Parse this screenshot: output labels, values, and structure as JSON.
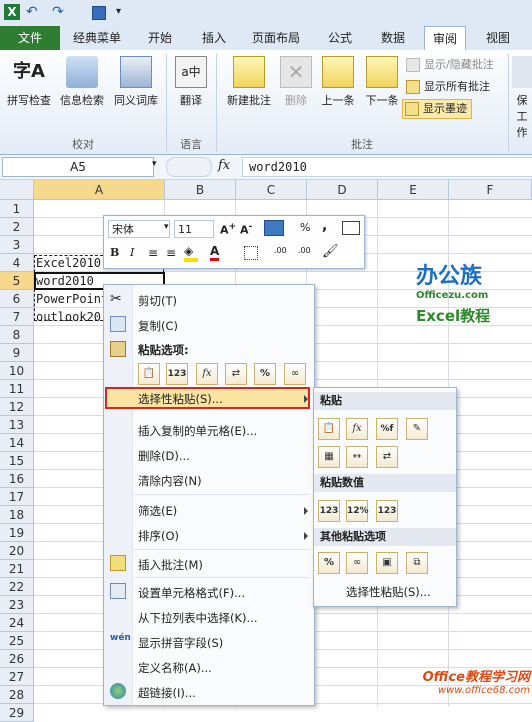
{
  "tabs": [
    "文件",
    "经典菜单",
    "开始",
    "插入",
    "页面布局",
    "公式",
    "数据",
    "审阅",
    "视图"
  ],
  "ribbon": {
    "proofing": {
      "group": "校对",
      "buttons": [
        "拼写检查",
        "信息检索",
        "同义词库"
      ]
    },
    "language": {
      "group": "语言",
      "buttons": [
        "翻译"
      ]
    },
    "comments": {
      "group": "批注",
      "buttons": [
        "新建批注",
        "删除",
        "上一条",
        "下一条"
      ],
      "small": [
        "显示/隐藏批注",
        "显示所有批注",
        "显示墨迹"
      ]
    },
    "protect_partial": "保",
    "protect_partial2": "工作"
  },
  "formula_bar": {
    "name_box": "A5",
    "fx": "fx",
    "value": "word2010"
  },
  "columns": [
    "A",
    "B",
    "C",
    "D",
    "E",
    "F"
  ],
  "rows": [
    "1",
    "2",
    "3",
    "4",
    "5",
    "6",
    "7",
    "8",
    "9",
    "10",
    "11",
    "12",
    "13",
    "14",
    "15",
    "16",
    "17",
    "18",
    "19",
    "20",
    "21",
    "22",
    "23",
    "24",
    "25",
    "26",
    "27",
    "28",
    "29"
  ],
  "cells": {
    "a4": "Excel2010",
    "a5": "word2010",
    "a6": "PowerPoint",
    "a7": "outlook20"
  },
  "mini_toolbar": {
    "font": "宋体",
    "size": "11",
    "percent": "%",
    "comma": ","
  },
  "context_menu": {
    "cut": "剪切(T)",
    "copy": "复制(C)",
    "paste_options": "粘贴选项:",
    "paste_special": "选择性粘贴(S)...",
    "insert_copied": "插入复制的单元格(E)...",
    "delete": "删除(D)...",
    "clear": "清除内容(N)",
    "filter": "筛选(E)",
    "sort": "排序(O)",
    "insert_comment": "插入批注(M)",
    "format_cells": "设置单元格格式(F)...",
    "pick_list": "从下拉列表中选择(K)...",
    "phonetic": "显示拼音字段(S)",
    "define_name": "定义名称(A)...",
    "hyperlink": "超链接(I)..."
  },
  "submenu": {
    "paste": "粘贴",
    "paste_values": "粘贴数值",
    "other": "其他粘贴选项",
    "paste_special": "选择性粘贴(S)..."
  },
  "logos": {
    "bangong": "办公族",
    "site": "Officezu.com",
    "excel": "Excel教程",
    "footer": "Office教程学习网",
    "footer_url": "www.office68.com"
  },
  "colors": {
    "file_tab": "#2f7d32",
    "highlight": "#d9261c",
    "ribbon": "#dfe9f5"
  }
}
